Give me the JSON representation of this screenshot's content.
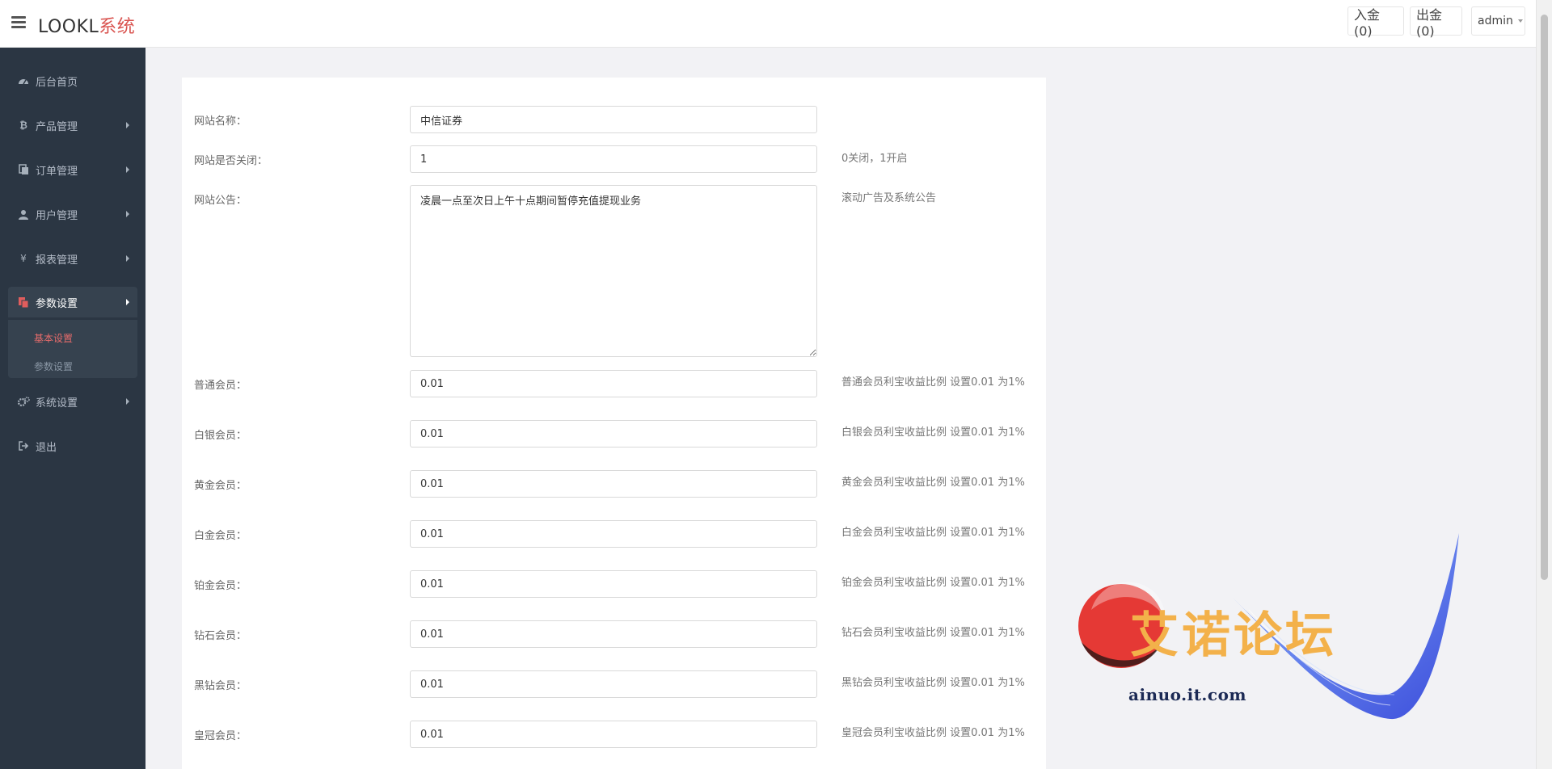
{
  "header": {
    "brand_main": "LOOKL",
    "brand_accent": "系统",
    "deposit_label": "入金(0)",
    "withdraw_label": "出金(0)",
    "user_label": "admin"
  },
  "sidebar": {
    "items": [
      {
        "label": "后台首页",
        "icon": "dashboard-icon"
      },
      {
        "label": "产品管理",
        "icon": "bitcoin-icon"
      },
      {
        "label": "订单管理",
        "icon": "copy-icon"
      },
      {
        "label": "用户管理",
        "icon": "user-icon"
      },
      {
        "label": "报表管理",
        "icon": "yen-icon"
      },
      {
        "label": "参数设置",
        "icon": "files-icon"
      },
      {
        "label": "系统设置",
        "icon": "gears-icon"
      },
      {
        "label": "退出",
        "icon": "sign-out-icon"
      }
    ],
    "sub_items": [
      {
        "label": "基本设置"
      },
      {
        "label": "参数设置"
      }
    ]
  },
  "form": {
    "fields": [
      {
        "label": "网站名称：",
        "value": "中信证券",
        "help": ""
      },
      {
        "label": "网站是否关闭：",
        "value": "1",
        "help": "0关闭，1开启"
      },
      {
        "label": "网站公告：",
        "value": "凌晨一点至次日上午十点期间暂停充值提现业务",
        "help": "滚动广告及系统公告"
      },
      {
        "label": "普通会员：",
        "value": "0.01",
        "help": "普通会员利宝收益比例 设置0.01 为1%"
      },
      {
        "label": "白银会员：",
        "value": "0.01",
        "help": "白银会员利宝收益比例 设置0.01 为1%"
      },
      {
        "label": "黄金会员：",
        "value": "0.01",
        "help": "黄金会员利宝收益比例 设置0.01 为1%"
      },
      {
        "label": "白金会员：",
        "value": "0.01",
        "help": "白金会员利宝收益比例 设置0.01 为1%"
      },
      {
        "label": "铂金会员：",
        "value": "0.01",
        "help": "铂金会员利宝收益比例 设置0.01 为1%"
      },
      {
        "label": "钻石会员：",
        "value": "0.01",
        "help": "钻石会员利宝收益比例 设置0.01 为1%"
      },
      {
        "label": "黑钻会员：",
        "value": "0.01",
        "help": "黑钻会员利宝收益比例 设置0.01 为1%"
      },
      {
        "label": "皇冠会员：",
        "value": "0.01",
        "help": "皇冠会员利宝收益比例 设置0.01 为1%"
      }
    ]
  },
  "watermark": {
    "text": "艾诺论坛",
    "url": "ainuo.it.com"
  },
  "colors": {
    "sidebar_bg": "#2b3643",
    "accent_red": "#d9534f",
    "watermark_orange": "#f3b14a"
  }
}
